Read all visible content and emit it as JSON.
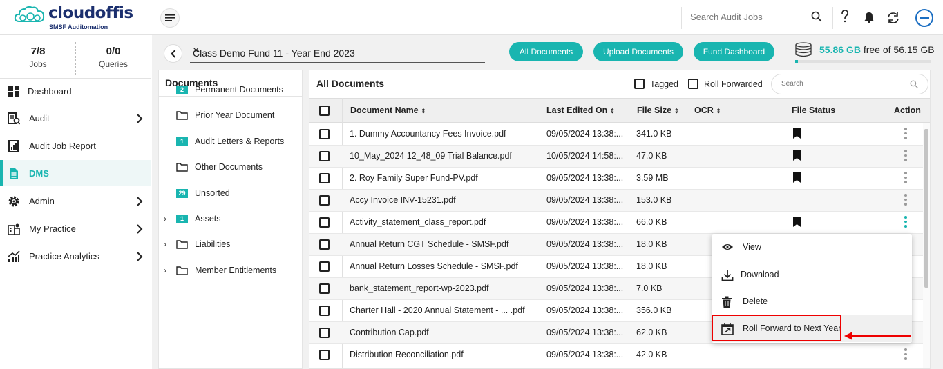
{
  "app": {
    "brand": "cloudoffis",
    "tagline": "SMSF Auditomation"
  },
  "topbar": {
    "search_placeholder": "Search Audit Jobs"
  },
  "stats": [
    {
      "value": "7/8",
      "label": "Jobs"
    },
    {
      "value": "0/0",
      "label": "Queries"
    }
  ],
  "sidebar": {
    "items": [
      {
        "label": "Dashboard",
        "icon": "dashboard-icon"
      },
      {
        "label": "Audit",
        "icon": "audit-icon"
      },
      {
        "label": "Audit Job Report",
        "icon": "report-icon"
      },
      {
        "label": "DMS",
        "icon": "document-icon",
        "active": true
      },
      {
        "label": "Admin",
        "icon": "gear-icon"
      },
      {
        "label": "My Practice",
        "icon": "practice-icon"
      },
      {
        "label": "Practice Analytics",
        "icon": "analytics-icon"
      }
    ]
  },
  "job": {
    "name": "Class Demo Fund 11  - Year End 2023"
  },
  "actions": {
    "all_documents": "All Documents",
    "upload_documents": "Upload Documents",
    "fund_dashboard": "Fund Dashboard"
  },
  "storage": {
    "used": "55.86 GB",
    "rest": "free of 56.15 GB",
    "fill": 0.02
  },
  "documents_panel": {
    "title": "Documents",
    "folders": [
      {
        "label": "Permanent Documents",
        "count": "2"
      },
      {
        "label": "Prior Year Document",
        "count": ""
      },
      {
        "label": "Audit Letters & Reports",
        "count": "1"
      },
      {
        "label": "Other Documents",
        "count": ""
      },
      {
        "label": "Unsorted",
        "count": "29"
      },
      {
        "label": "Assets",
        "count": "1",
        "expandable": true
      },
      {
        "label": "Liabilities",
        "count": "",
        "expandable": true
      },
      {
        "label": "Member Entitlements",
        "count": "",
        "expandable": true
      }
    ]
  },
  "table": {
    "title": "All Documents",
    "filter_tagged": "Tagged",
    "filter_roll": "Roll Forwarded",
    "search_placeholder": "Search",
    "columns": {
      "name": "Document Name",
      "edited": "Last Edited On",
      "size": "File Size",
      "ocr": "OCR",
      "status": "File Status",
      "action": "Action"
    },
    "rows": [
      {
        "name": "1. Dummy Accountancy Fees Invoice.pdf",
        "edited": "09/05/2024 13:38:...",
        "size": "341.0 KB",
        "tagged": true
      },
      {
        "name": "10_May_2024 12_48_09 Trial Balance.pdf",
        "edited": "10/05/2024 14:58:...",
        "size": "47.0 KB",
        "tagged": true
      },
      {
        "name": "2. Roy Family Super Fund-PV.pdf",
        "edited": "09/05/2024 13:38:...",
        "size": "3.59 MB",
        "tagged": true
      },
      {
        "name": "Accy Invoice INV-15231.pdf",
        "edited": "09/05/2024 13:38:...",
        "size": "153.0 KB",
        "tagged": false
      },
      {
        "name": "Activity_statement_class_report.pdf",
        "edited": "09/05/2024 13:38:...",
        "size": "66.0 KB",
        "tagged": true
      },
      {
        "name": "Annual Return CGT Schedule - SMSF.pdf",
        "edited": "09/05/2024 13:38:...",
        "size": "18.0 KB",
        "tagged": false
      },
      {
        "name": "Annual Return Losses Schedule - SMSF.pdf",
        "edited": "09/05/2024 13:38:...",
        "size": "18.0 KB",
        "tagged": false
      },
      {
        "name": "bank_statement_report-wp-2023.pdf",
        "edited": "09/05/2024 13:38:...",
        "size": "7.0 KB",
        "tagged": false
      },
      {
        "name": "Charter Hall - 2020 Annual Statement - ...  .pdf",
        "edited": "09/05/2024 13:38:...",
        "size": "356.0 KB",
        "tagged": false
      },
      {
        "name": "Contribution Cap.pdf",
        "edited": "09/05/2024 13:38:...",
        "size": "62.0 KB",
        "tagged": false
      },
      {
        "name": "Distribution Reconciliation.pdf",
        "edited": "09/05/2024 13:38:...",
        "size": "42.0 KB",
        "tagged": false
      }
    ]
  },
  "context_menu": {
    "items": [
      {
        "label": "View",
        "icon": "eye-icon"
      },
      {
        "label": "Download",
        "icon": "download-icon"
      },
      {
        "label": "Delete",
        "icon": "trash-icon"
      },
      {
        "label": "Roll Forward to Next Year",
        "icon": "roll-forward-icon"
      }
    ]
  },
  "colors": {
    "accent": "#19b5b0",
    "brand": "#1b2f6e",
    "highlight": "#e00000"
  }
}
